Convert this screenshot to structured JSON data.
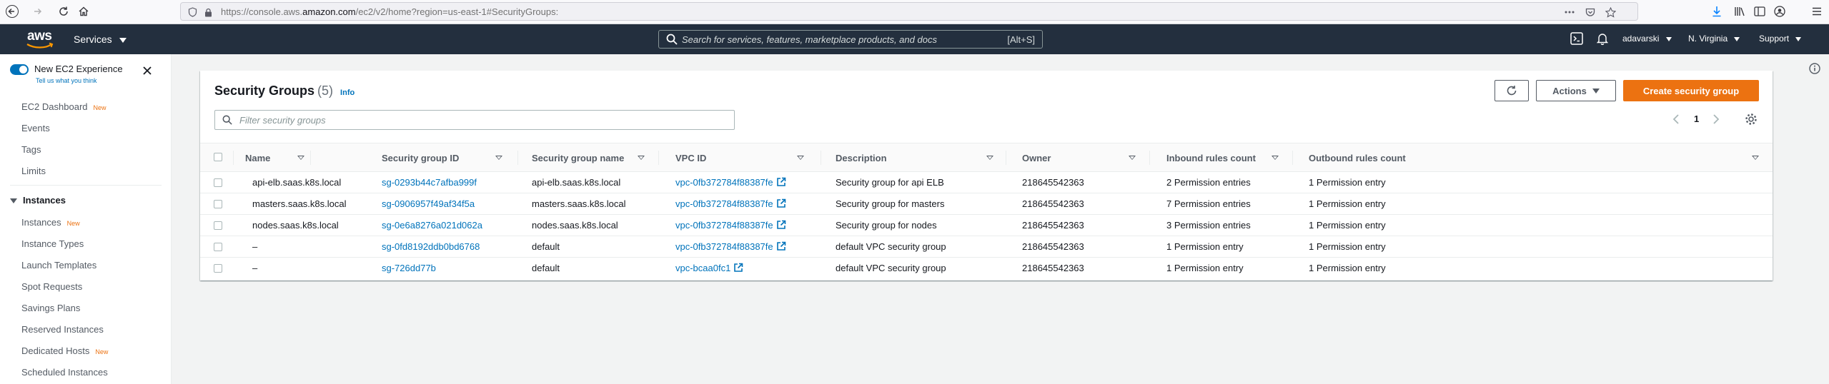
{
  "browser": {
    "url_prefix": "https://console.aws.",
    "url_domain": "amazon.com",
    "url_suffix": "/ec2/v2/home?region=us-east-1#SecurityGroups:"
  },
  "topnav": {
    "logo_text": "aws",
    "services_label": "Services",
    "search_placeholder": "Search for services, features, marketplace products, and docs",
    "search_shortcut": "[Alt+S]",
    "user": "adavarski",
    "region": "N. Virginia",
    "support": "Support"
  },
  "sidebar": {
    "experience_title": "New EC2 Experience",
    "experience_sub": "Tell us what you think",
    "new_badge": "New",
    "items": [
      {
        "label": "EC2 Dashboard",
        "new": true
      },
      {
        "label": "Events",
        "new": false
      },
      {
        "label": "Tags",
        "new": false
      },
      {
        "label": "Limits",
        "new": false
      }
    ],
    "instances_section": "Instances",
    "instance_items": [
      {
        "label": "Instances",
        "new": true
      },
      {
        "label": "Instance Types",
        "new": false
      },
      {
        "label": "Launch Templates",
        "new": false
      },
      {
        "label": "Spot Requests",
        "new": false
      },
      {
        "label": "Savings Plans",
        "new": false
      },
      {
        "label": "Reserved Instances",
        "new": false
      },
      {
        "label": "Dedicated Hosts",
        "new": true
      },
      {
        "label": "Scheduled Instances",
        "new": false
      }
    ]
  },
  "panel": {
    "title": "Security Groups",
    "count": "(5)",
    "info": "Info",
    "actions_label": "Actions",
    "create_label": "Create security group",
    "filter_placeholder": "Filter security groups",
    "page": "1"
  },
  "table": {
    "columns": [
      "Name",
      "Security group ID",
      "Security group name",
      "VPC ID",
      "Description",
      "Owner",
      "Inbound rules count",
      "Outbound rules count"
    ],
    "rows": [
      {
        "name": "api-elb.saas.k8s.local",
        "sg_id": "sg-0293b44c7afba999f",
        "sg_name": "api-elb.saas.k8s.local",
        "vpc": "vpc-0fb372784f88387fe",
        "desc": "Security group for api ELB",
        "owner": "218645542363",
        "inbound": "2 Permission entries",
        "outbound": "1 Permission entry"
      },
      {
        "name": "masters.saas.k8s.local",
        "sg_id": "sg-0906957f49af34f5a",
        "sg_name": "masters.saas.k8s.local",
        "vpc": "vpc-0fb372784f88387fe",
        "desc": "Security group for masters",
        "owner": "218645542363",
        "inbound": "7 Permission entries",
        "outbound": "1 Permission entry"
      },
      {
        "name": "nodes.saas.k8s.local",
        "sg_id": "sg-0e6a8276a021d062a",
        "sg_name": "nodes.saas.k8s.local",
        "vpc": "vpc-0fb372784f88387fe",
        "desc": "Security group for nodes",
        "owner": "218645542363",
        "inbound": "3 Permission entries",
        "outbound": "1 Permission entry"
      },
      {
        "name": "–",
        "sg_id": "sg-0fd8192ddb0bd6768",
        "sg_name": "default",
        "vpc": "vpc-0fb372784f88387fe",
        "desc": "default VPC security group",
        "owner": "218645542363",
        "inbound": "1 Permission entry",
        "outbound": "1 Permission entry"
      },
      {
        "name": "–",
        "sg_id": "sg-726dd77b",
        "sg_name": "default",
        "vpc": "vpc-bcaa0fc1",
        "desc": "default VPC security group",
        "owner": "218645542363",
        "inbound": "1 Permission entry",
        "outbound": "1 Permission entry"
      }
    ]
  },
  "colors": {
    "accent": "#0073bb",
    "primary_button": "#ec7211",
    "nav_bg": "#232f3e"
  },
  "icons": [
    "back-icon",
    "forward-icon",
    "reload-icon",
    "home-icon",
    "shield-icon",
    "lock-icon",
    "qr-icon",
    "pocket-icon",
    "star-icon",
    "download-icon",
    "library-icon",
    "sidebar-icon",
    "account-icon",
    "menu-icon",
    "search-icon",
    "cloudshell-icon",
    "bell-icon",
    "close-icon",
    "refresh-icon",
    "gear-icon",
    "external-link-icon",
    "info-icon"
  ]
}
